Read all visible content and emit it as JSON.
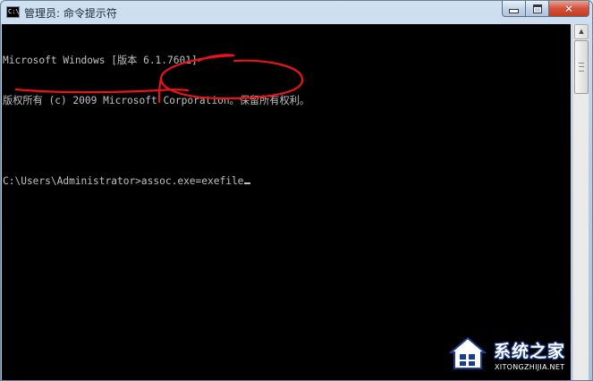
{
  "window": {
    "title": "管理员: 命令提示符",
    "icon": "cmd-icon",
    "icon_text": "C:\\",
    "controls": {
      "minimize": "minimize-icon",
      "maximize": "maximize-icon",
      "close": "close-icon",
      "close_color": "#c63a1f"
    }
  },
  "terminal": {
    "background": "#000000",
    "foreground": "#c0c0c0",
    "lines": [
      "Microsoft Windows [版本 6.1.7601]",
      "版权所有 (c) 2009 Microsoft Corporation。保留所有权利。",
      "",
      "C:\\Users\\Administrator>assoc.exe=exefile"
    ]
  },
  "annotation": {
    "color": "#e8141a"
  },
  "watermark": {
    "name": "系统之家",
    "url": "XITONGZHIJIA.NET"
  }
}
